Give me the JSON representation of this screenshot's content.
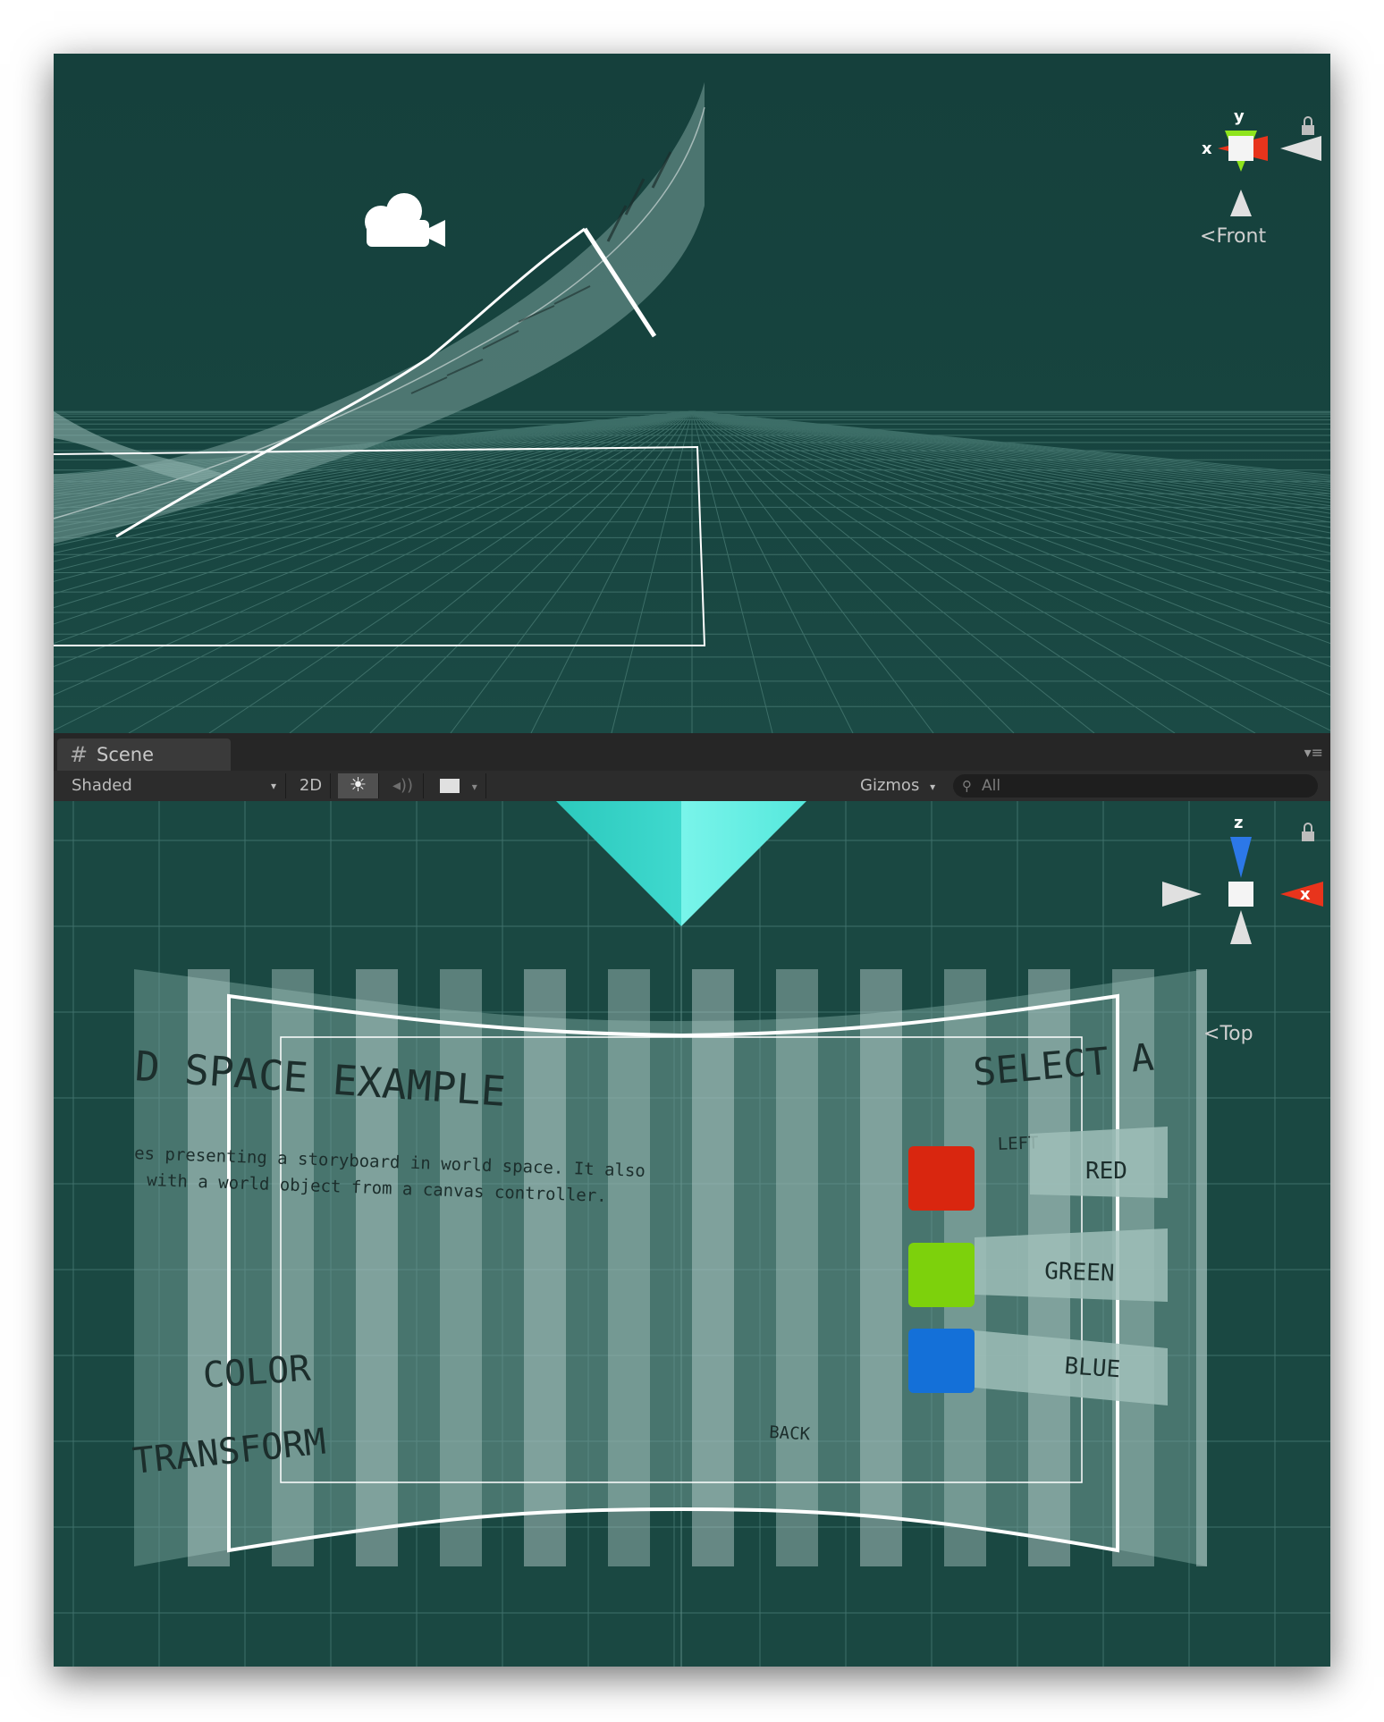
{
  "top_view": {
    "gizmo": {
      "y_label": "y",
      "x_label": "x",
      "orientation": "Front"
    }
  },
  "scene_tab": {
    "label": "Scene",
    "icon": "hash-icon"
  },
  "toolbar": {
    "shading_mode": "Shaded",
    "mode_2d": "2D",
    "lighting_icon": "sun-icon",
    "audio_icon": "speaker-icon",
    "effects_icon": "image-icon",
    "gizmos_label": "Gizmos",
    "search_placeholder": "All"
  },
  "bottom_view": {
    "gizmo": {
      "z_label": "z",
      "x_label": "x",
      "orientation": "Top"
    },
    "canvas_texts": {
      "title": "D SPACE EXAMPLE",
      "desc_line1": "es presenting a storyboard in world space. It also",
      "desc_line2": "with a world object from a canvas controller.",
      "select_heading": "SELECT A",
      "left_label": "LEFT",
      "color_heading": "COLOR",
      "transform_heading": "TRANSFORM",
      "back_label": "BACK"
    },
    "color_buttons": [
      {
        "label": "RED",
        "color": "#d9260f"
      },
      {
        "label": "GREEN",
        "color": "#7dd10c"
      },
      {
        "label": "BLUE",
        "color": "#1470d8"
      }
    ]
  },
  "colors": {
    "scene_background": "#16423e",
    "grid_line": "#3f706b",
    "camera_cone": "#35e4d7",
    "toolbar_bg": "#2c2c2c",
    "gizmo_x": "#e8341c",
    "gizmo_y": "#8ee41c",
    "gizmo_z": "#2c78e8"
  }
}
